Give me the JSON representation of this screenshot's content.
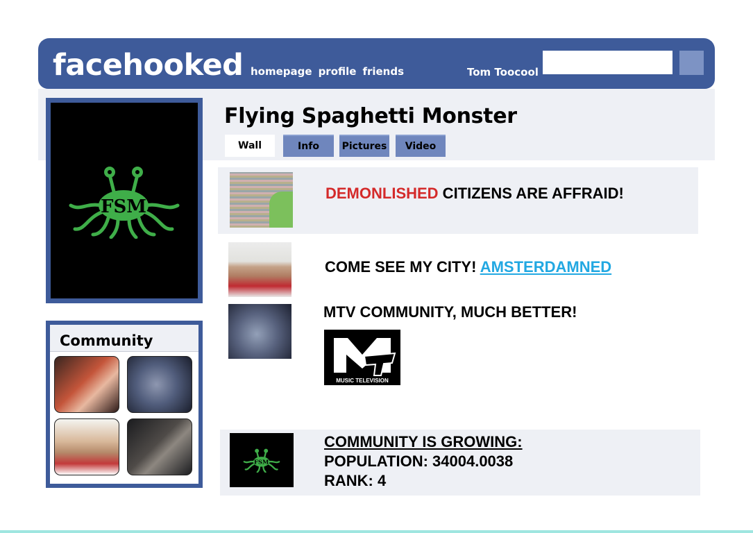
{
  "header": {
    "logo": "facehooked",
    "nav": [
      "homepage",
      "profile",
      "friends"
    ],
    "user_name": "Tom Toocool",
    "search": {
      "value": "",
      "placeholder": ""
    }
  },
  "profile": {
    "name": "Flying Spaghetti Monster",
    "picture_text": "FSM"
  },
  "tabs": [
    {
      "label": "Wall",
      "active": true
    },
    {
      "label": "Info",
      "active": false
    },
    {
      "label": "Pictures",
      "active": false
    },
    {
      "label": "Video",
      "active": false
    }
  ],
  "community": {
    "title": "Community"
  },
  "wall": {
    "post1": {
      "highlight": "DEMONLISHED",
      "text": " CITIZENS ARE AFFRAID!"
    },
    "post2": {
      "text": "COME SEE MY CITY! ",
      "link": "AMSTERDAMNED"
    },
    "post3": {
      "text": "MTV COMMUNITY, MUCH BETTER!",
      "logo_caption": "MUSIC TELEVISION"
    },
    "post4": {
      "heading": "COMMUNITY IS GROWING: ",
      "population": "POPULATION: 34004.0038",
      "rank": "RANK: 4",
      "logo_text": "FSM"
    }
  },
  "colors": {
    "brand": "#3e5b9a",
    "tab_inactive": "#6f86bd",
    "panel": "#eef0f5",
    "fsm_green": "#3fae49",
    "alert_red": "#d42a2a",
    "link_blue": "#22a8e2"
  }
}
